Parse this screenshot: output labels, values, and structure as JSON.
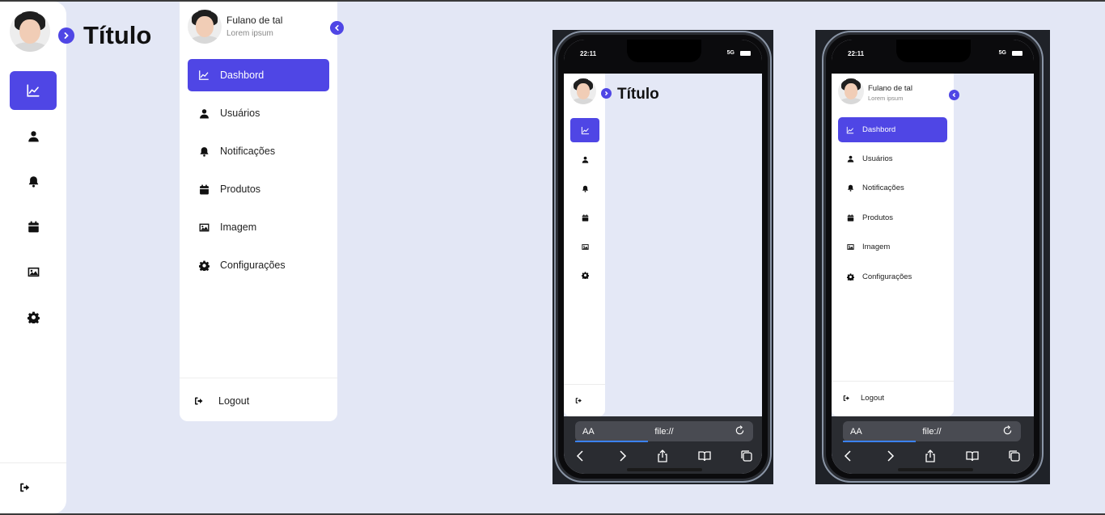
{
  "page": {
    "title": "Título",
    "background": "#e3e7f5",
    "accent": "#4f46e5"
  },
  "user": {
    "name": "Fulano de tal",
    "subtitle": "Lorem ipsum"
  },
  "menu": [
    {
      "label": "Dashbord",
      "icon": "chart-line-icon",
      "active": true
    },
    {
      "label": "Usuários",
      "icon": "user-icon",
      "active": false
    },
    {
      "label": "Notificações",
      "icon": "bell-icon",
      "active": false
    },
    {
      "label": "Produtos",
      "icon": "calendar-icon",
      "active": false
    },
    {
      "label": "Imagem",
      "icon": "image-icon",
      "active": false
    },
    {
      "label": "Configurações",
      "icon": "gear-icon",
      "active": false
    }
  ],
  "logout": {
    "label": "Logout",
    "icon": "logout-icon"
  },
  "phone": {
    "time": "22:11",
    "signal": "5G",
    "url": "file://",
    "text_size_label": "AA"
  }
}
